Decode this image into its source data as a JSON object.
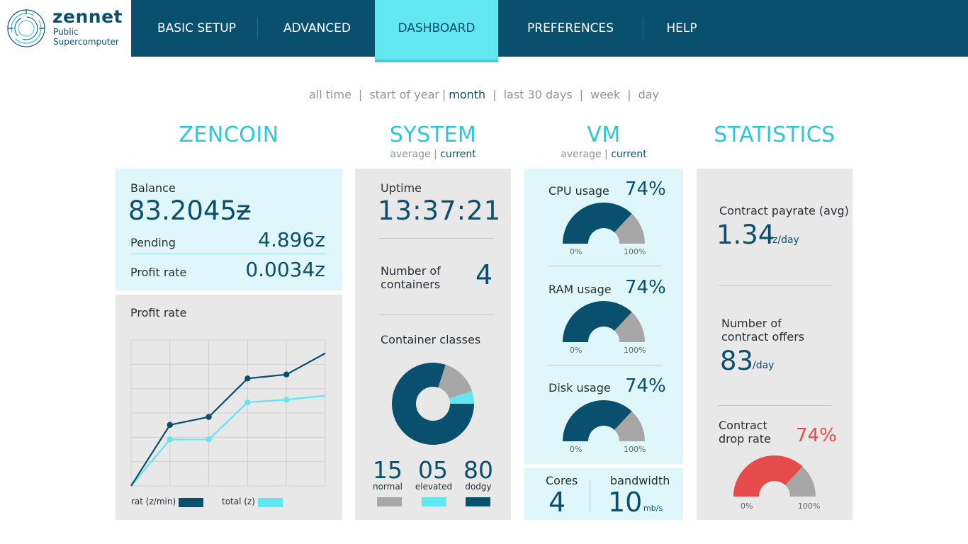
{
  "brand": {
    "name": "zennet",
    "sub1": "Public",
    "sub2": "Supercomputer"
  },
  "nav": {
    "items": [
      "BASIC SETUP",
      "ADVANCED",
      "DASHBOARD",
      "PREFERENCES",
      "HELP"
    ],
    "active": "DASHBOARD"
  },
  "time_filter": {
    "options": [
      "all time",
      "start of year",
      "month",
      "last 30 days",
      "week",
      "day"
    ],
    "active": "month"
  },
  "zencoin": {
    "title": "ZENCOIN",
    "balance_label": "Balance",
    "balance_value": "83.2045",
    "pending_label": "Pending",
    "pending_value": "4.896",
    "profit_label": "Profit rate",
    "profit_value": "0.0034",
    "currency": "z",
    "chart_title": "Profit rate",
    "legend_rate": "rat (z/min)",
    "legend_total": "total (z)"
  },
  "system": {
    "title": "SYSTEM",
    "toggle_average": "average",
    "toggle_current": "current",
    "uptime_label": "Uptime",
    "uptime_value": "13:37:21",
    "containers_label_1": "Number of",
    "containers_label_2": "containers",
    "containers_value": "4",
    "classes_label": "Container classes",
    "classes": [
      {
        "count": "15",
        "name": "normal",
        "color": "#a7a7a7"
      },
      {
        "count": "05",
        "name": "elevated",
        "color": "#62e6ef"
      },
      {
        "count": "80",
        "name": "dodgy",
        "color": "#08506d"
      }
    ]
  },
  "vm": {
    "title": "VM",
    "toggle_average": "average",
    "toggle_current": "current",
    "gauges": [
      {
        "label": "CPU usage",
        "value": "74%",
        "min": "0%",
        "max": "100%",
        "fraction": 0.74
      },
      {
        "label": "RAM usage",
        "value": "74%",
        "min": "0%",
        "max": "100%",
        "fraction": 0.74
      },
      {
        "label": "Disk usage",
        "value": "74%",
        "min": "0%",
        "max": "100%",
        "fraction": 0.74
      }
    ],
    "cores_label": "Cores",
    "cores_value": "4",
    "bandwidth_label": "bandwidth",
    "bandwidth_value": "10",
    "bandwidth_unit": "mb/s"
  },
  "statistics": {
    "title": "STATISTICS",
    "payrate_label": "Contract payrate (avg)",
    "payrate_value": "1.34",
    "payrate_unit": "z/day",
    "offers_label_1": "Number of",
    "offers_label_2": "contract offers",
    "offers_value": "83",
    "offers_unit": "/day",
    "drop_label_1": "Contract",
    "drop_label_2": "drop rate",
    "drop_value": "74%",
    "drop_min": "0%",
    "drop_max": "100%",
    "drop_fraction": 0.74
  },
  "colors": {
    "dark": "#08506d",
    "teal": "#62e6ef",
    "grey": "#a7a7a7",
    "red": "#e64b4b"
  },
  "chart_data": {
    "type": "line",
    "title": "Profit rate",
    "x": [
      0,
      1,
      2,
      3,
      4,
      5
    ],
    "series": [
      {
        "name": "rat (z/min)",
        "values": [
          0,
          0.46,
          0.52,
          0.81,
          0.84,
          1.0
        ]
      },
      {
        "name": "total (z)",
        "values": [
          0,
          0.35,
          0.35,
          0.63,
          0.65,
          0.68
        ]
      }
    ],
    "ylim": [
      0,
      1.1
    ],
    "grid": true,
    "legend": "bottom"
  }
}
